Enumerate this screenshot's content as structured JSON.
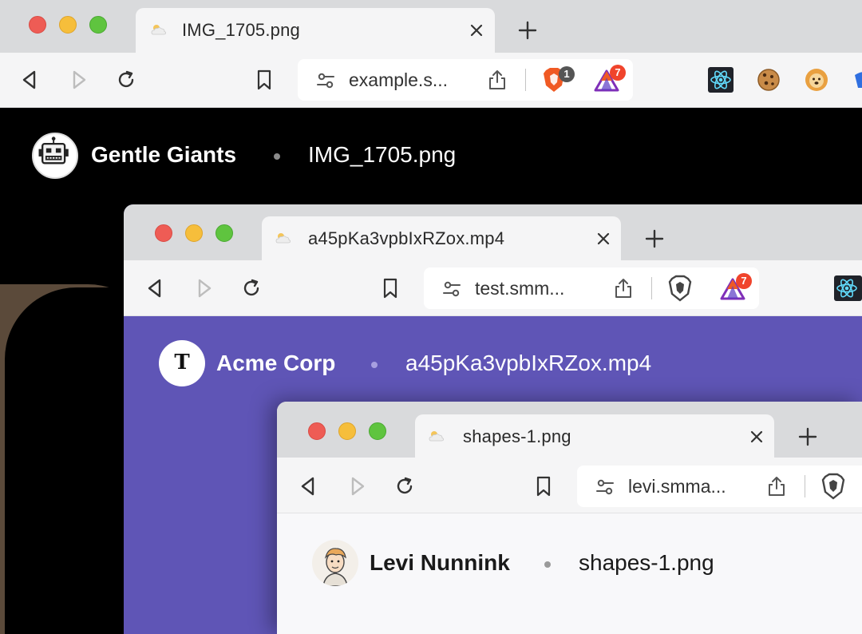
{
  "windows": [
    {
      "tab": {
        "title": "IMG_1705.png"
      },
      "url": "example.s...",
      "extensions": {
        "brave_badge": "1",
        "rewards_badge": "7"
      },
      "page": {
        "site_name": "Gentle Giants",
        "file_name": "IMG_1705.png"
      }
    },
    {
      "tab": {
        "title": "a45pKa3vpbIxRZox.mp4"
      },
      "url": "test.smm...",
      "extensions": {
        "rewards_badge": "7"
      },
      "page": {
        "site_name": "Acme Corp",
        "avatar_letter": "T",
        "file_name": "a45pKa3vpbIxRZox.mp4"
      }
    },
    {
      "tab": {
        "title": "shapes-1.png"
      },
      "url": "levi.smma...",
      "page": {
        "site_name": "Levi Nunnink",
        "file_name": "shapes-1.png"
      }
    }
  ],
  "colors": {
    "accent_purple": "#5f55b6",
    "badge_red": "#f0442c",
    "badge_gray": "#555555"
  }
}
